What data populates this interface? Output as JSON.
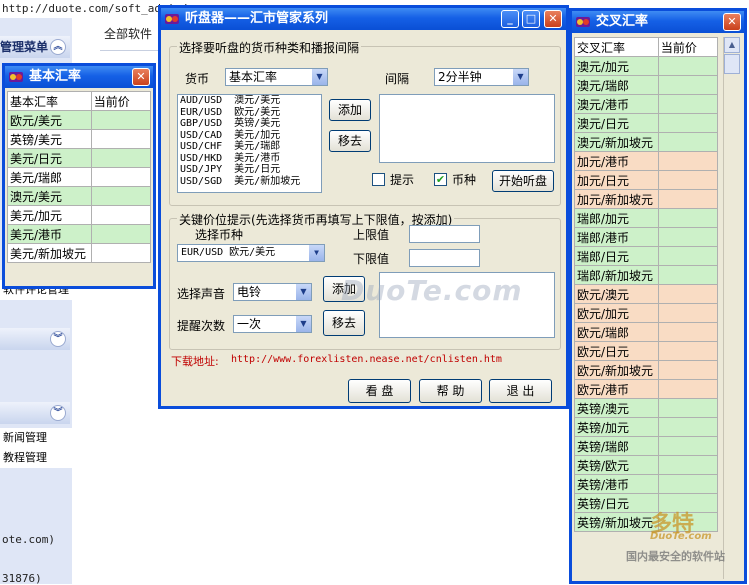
{
  "background": {
    "address": "http://duote.com/soft_admin/a",
    "menu_header": "管理菜单",
    "right_label": "全部软件",
    "left_item": "软件评论管理",
    "news": "新闻管理",
    "tutorial": "教程管理",
    "footer1": "ote.com)",
    "footer2": "31876)"
  },
  "main": {
    "title": "听盘器——汇市管家系列",
    "group1_title": "选择要听盘的货币种类和播报间隔",
    "currency_label": "货币",
    "currency_value": "基本汇率",
    "interval_label": "间隔",
    "interval_value": "2分半钟",
    "currency_list": [
      "AUD/USD  澳元/美元",
      "EUR/USD  欧元/美元",
      "GBP/USD  英镑/美元",
      "USD/CAD  美元/加元",
      "USD/CHF  美元/瑞郎",
      "USD/HKD  美元/港币",
      "USD/JPY  美元/日元",
      "USD/SGD  美元/新加坡元"
    ],
    "add_label": "添加",
    "remove_label": "移去",
    "hint_label": "提示",
    "hint_checked": false,
    "currency_check_label": "币种",
    "currency_checked": true,
    "start_label": "开始听盘",
    "group2_title": "关键价位提示(先选择货币再填写上下限值，按添加)",
    "select_currency_label": "选择币种",
    "select_currency_value": "EUR/USD  欧元/美元",
    "upper_label": "上限值",
    "lower_label": "下限值",
    "sound_label": "选择声音",
    "sound_value": "电铃",
    "times_label": "提醒次数",
    "times_value": "一次",
    "add2_label": "添加",
    "remove2_label": "移去",
    "download_label": "下载地址:",
    "download_url": "http://www.forexlisten.nease.net/cnlisten.htm",
    "view_label": "看 盘",
    "help_label": "帮 助",
    "exit_label": "退 出",
    "watermark": "DuoTe.com"
  },
  "basic": {
    "title": "基本汇率",
    "col1": "基本汇率",
    "col2": "当前价",
    "rows": [
      {
        "name": "欧元/美元",
        "color": "#cdf1c9"
      },
      {
        "name": "英镑/美元",
        "color": "#ffffff"
      },
      {
        "name": "美元/日元",
        "color": "#cdf1c9"
      },
      {
        "name": "美元/瑞郎",
        "color": "#ffffff"
      },
      {
        "name": "澳元/美元",
        "color": "#cdf1c9"
      },
      {
        "name": "美元/加元",
        "color": "#ffffff"
      },
      {
        "name": "美元/港币",
        "color": "#cdf1c9"
      },
      {
        "name": "美元/新加坡元",
        "color": "#ffffff"
      }
    ]
  },
  "cross": {
    "title": "交叉汇率",
    "col1": "交叉汇率",
    "col2": "当前价",
    "rows": [
      {
        "name": "澳元/加元",
        "color": "#cdf1c9"
      },
      {
        "name": "澳元/瑞郎",
        "color": "#cdf1c9"
      },
      {
        "name": "澳元/港币",
        "color": "#cdf1c9"
      },
      {
        "name": "澳元/日元",
        "color": "#cdf1c9"
      },
      {
        "name": "澳元/新加坡元",
        "color": "#cdf1c9"
      },
      {
        "name": "加元/港币",
        "color": "#f9dcc4"
      },
      {
        "name": "加元/日元",
        "color": "#f9dcc4"
      },
      {
        "name": "加元/新加坡元",
        "color": "#f9dcc4"
      },
      {
        "name": "瑞郎/加元",
        "color": "#cdf1c9"
      },
      {
        "name": "瑞郎/港币",
        "color": "#cdf1c9"
      },
      {
        "name": "瑞郎/日元",
        "color": "#cdf1c9"
      },
      {
        "name": "瑞郎/新加坡元",
        "color": "#cdf1c9"
      },
      {
        "name": "欧元/澳元",
        "color": "#f9dcc4"
      },
      {
        "name": "欧元/加元",
        "color": "#f9dcc4"
      },
      {
        "name": "欧元/瑞郎",
        "color": "#f9dcc4"
      },
      {
        "name": "欧元/日元",
        "color": "#f9dcc4"
      },
      {
        "name": "欧元/新加坡元",
        "color": "#f9dcc4"
      },
      {
        "name": "欧元/港币",
        "color": "#f9dcc4"
      },
      {
        "name": "英镑/澳元",
        "color": "#cdf1c9"
      },
      {
        "name": "英镑/加元",
        "color": "#cdf1c9"
      },
      {
        "name": "英镑/瑞郎",
        "color": "#cdf1c9"
      },
      {
        "name": "英镑/欧元",
        "color": "#cdf1c9"
      },
      {
        "name": "英镑/港币",
        "color": "#cdf1c9"
      },
      {
        "name": "英镑/日元",
        "color": "#cdf1c9"
      },
      {
        "name": "英镑/新加坡元",
        "color": "#cdf1c9"
      }
    ]
  },
  "corner_watermark": {
    "brand": "多特",
    "sub": "DuoTe.com",
    "slogan": "国内最安全的软件站"
  }
}
